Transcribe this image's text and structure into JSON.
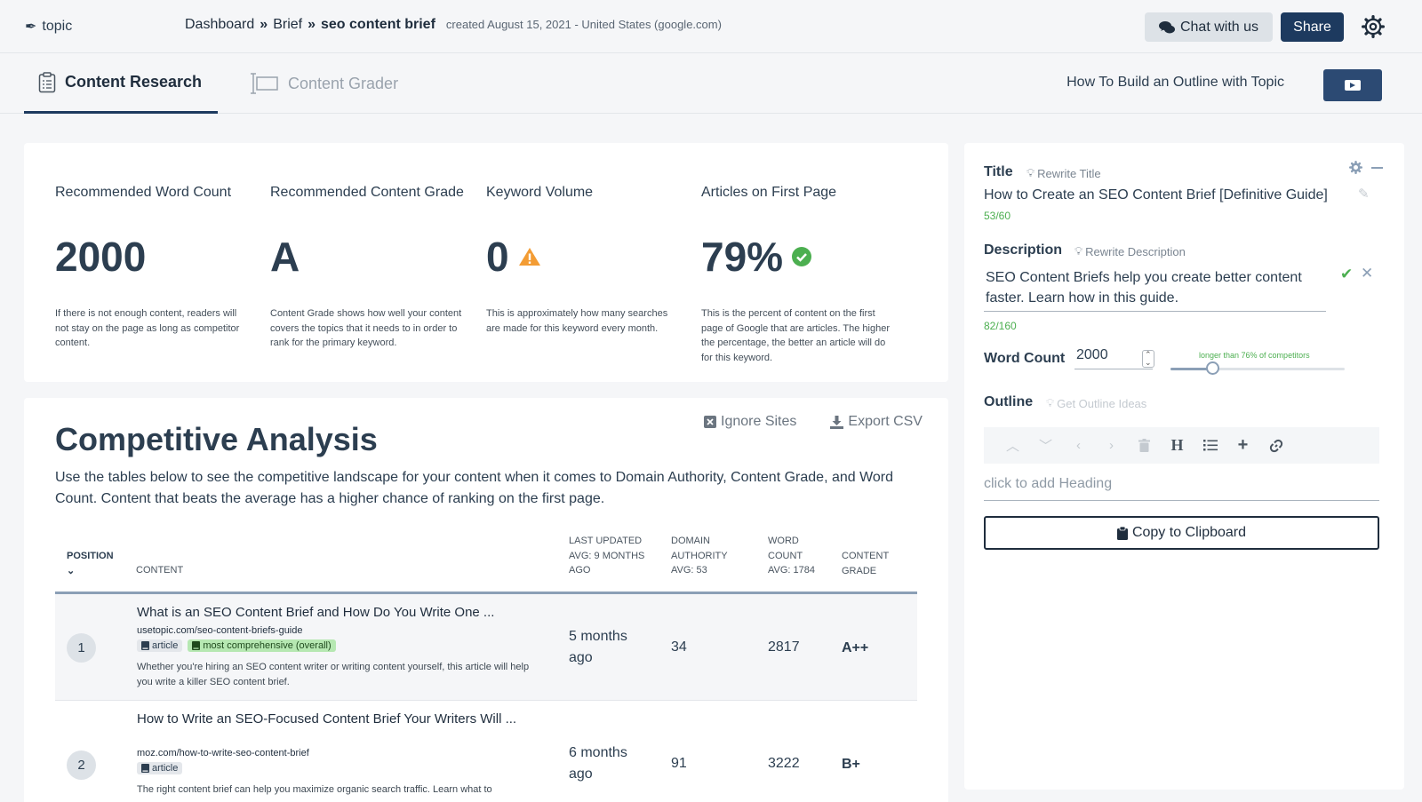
{
  "header": {
    "logo": "topic",
    "breadcrumb": [
      "Dashboard",
      "Brief",
      "seo content brief"
    ],
    "breadcrumb_sep": "»",
    "created": "created August 15, 2021 - United States (google.com)",
    "chat_label": "Chat with us",
    "share_label": "Share"
  },
  "tabs": [
    {
      "label": "Content Research",
      "active": true
    },
    {
      "label": "Content Grader",
      "active": false
    }
  ],
  "howto_label": "How To Build an Outline with Topic",
  "stats": [
    {
      "label": "Recommended Word Count",
      "value": "2000",
      "desc": "If there is not enough content, readers will not stay on the page as long as competitor content."
    },
    {
      "label": "Recommended Content Grade",
      "value": "A",
      "desc": "Content Grade shows how well your content covers the topics that it needs to in order to rank for the primary keyword."
    },
    {
      "label": "Keyword Volume",
      "value": "0",
      "desc": "This is approximately how many searches are made for this keyword every month."
    },
    {
      "label": "Articles on First Page",
      "value": "79%",
      "desc": "This is the percent of content on the first page of Google that are articles. The higher the percentage, the better an article will do for this keyword."
    }
  ],
  "competitive": {
    "title": "Competitive Analysis",
    "ignore_label": "Ignore Sites",
    "export_label": "Export CSV",
    "description": "Use the tables below to see the competitive landscape for your content when it comes to Domain Authority, Content Grade, and Word Count. Content that beats the average has a higher chance of ranking on the first page.",
    "columns": {
      "position": "POSITION",
      "content": "CONTENT",
      "last_updated": [
        "LAST UPDATED",
        "AVG: 9 MONTHS",
        "AGO"
      ],
      "domain_authority": [
        "DOMAIN",
        "AUTHORITY",
        "AVG: 53"
      ],
      "word_count": [
        "WORD",
        "COUNT",
        "AVG: 1784"
      ],
      "content_grade": [
        "CONTENT",
        "GRADE"
      ]
    },
    "rows": [
      {
        "position": "1",
        "title": "What is an SEO Content Brief and How Do You Write One ...",
        "url": "usetopic.com/seo-content-briefs-guide",
        "tags": [
          "article",
          "most comprehensive (overall)"
        ],
        "snippet": "Whether you're hiring an SEO content writer or writing content yourself, this article will help you write a killer SEO content brief.",
        "last_updated": [
          "5 months",
          "ago"
        ],
        "domain_authority": "34",
        "word_count": "2817",
        "grade": "A++"
      },
      {
        "position": "2",
        "title": "How to Write an SEO-Focused Content Brief Your Writers Will ...",
        "url": "moz.com/how-to-write-seo-content-brief",
        "tags": [
          "article"
        ],
        "snippet": "The right content brief can help you maximize organic search traffic. Learn what to",
        "last_updated": [
          "6 months",
          "ago"
        ],
        "domain_authority": "91",
        "word_count": "3222",
        "grade": "B+"
      }
    ]
  },
  "panel": {
    "title_label": "Title",
    "rewrite_title": "Rewrite Title",
    "title_value": "How to Create an SEO Content Brief [Definitive Guide]",
    "title_count": "53/60",
    "description_label": "Description",
    "rewrite_description": "Rewrite Description",
    "description_value": "SEO Content Briefs help you create better content faster. Learn how in this guide.",
    "description_count": "82/160",
    "word_count_label": "Word Count",
    "word_count_value": "2000",
    "slider_note": "longer than 76% of competitors",
    "slider_fraction": 0.24,
    "outline_label": "Outline",
    "outline_ideas": "Get Outline Ideas",
    "heading_placeholder": "click to add Heading",
    "copy_label": "Copy to Clipboard"
  }
}
